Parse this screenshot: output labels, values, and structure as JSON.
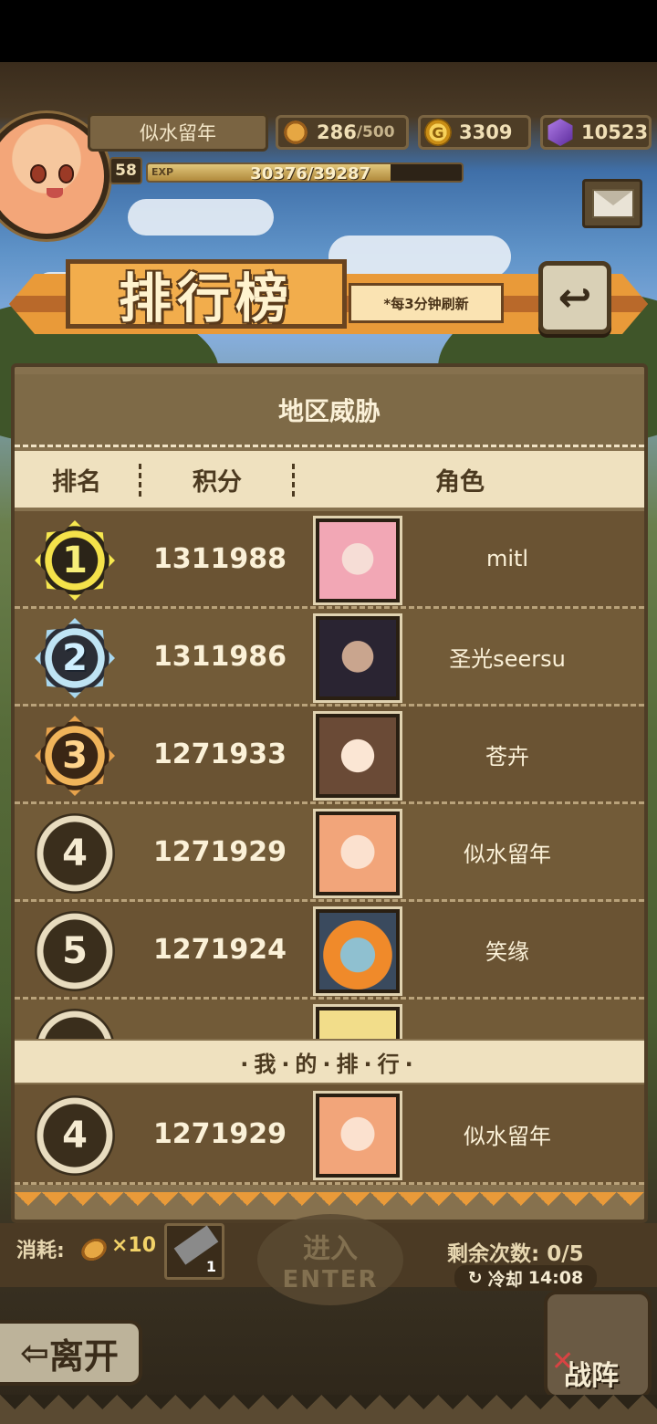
{
  "player": {
    "name": "似水留年",
    "level": "58",
    "exp_tag": "EXP",
    "exp_text": "30376/39287",
    "exp_fraction": 0.773
  },
  "resources": {
    "stamina": "286",
    "stamina_max": "/500",
    "gold": "3309",
    "gold_symbol": "G",
    "gems": "10523"
  },
  "banner": {
    "title": "排行榜",
    "note": "*每3分钟刷新"
  },
  "board": {
    "title": "地区威胁",
    "columns": {
      "rank": "排名",
      "score": "积分",
      "role": "角色"
    },
    "rows": [
      {
        "rank": "1",
        "score": "1311988",
        "name": "mitl"
      },
      {
        "rank": "2",
        "score": "1311986",
        "name": "圣光seersu"
      },
      {
        "rank": "3",
        "score": "1271933",
        "name": "苍卉"
      },
      {
        "rank": "4",
        "score": "1271929",
        "name": "似水留年"
      },
      {
        "rank": "5",
        "score": "1271924",
        "name": "笑缘"
      }
    ],
    "my_rank_label": "·我·的·排·行·",
    "my_row": {
      "rank": "4",
      "score": "1271929",
      "name": "似水留年"
    }
  },
  "bottom": {
    "cost_label": "消耗:",
    "cost_value": "×10",
    "item_count": "1",
    "enter_zh": "进入",
    "enter_en": "ENTER",
    "remaining": "剩余次数: 0/5",
    "cooldown_label": "冷却",
    "cooldown_time": "14:08",
    "leave": "离开",
    "team": "战阵"
  }
}
